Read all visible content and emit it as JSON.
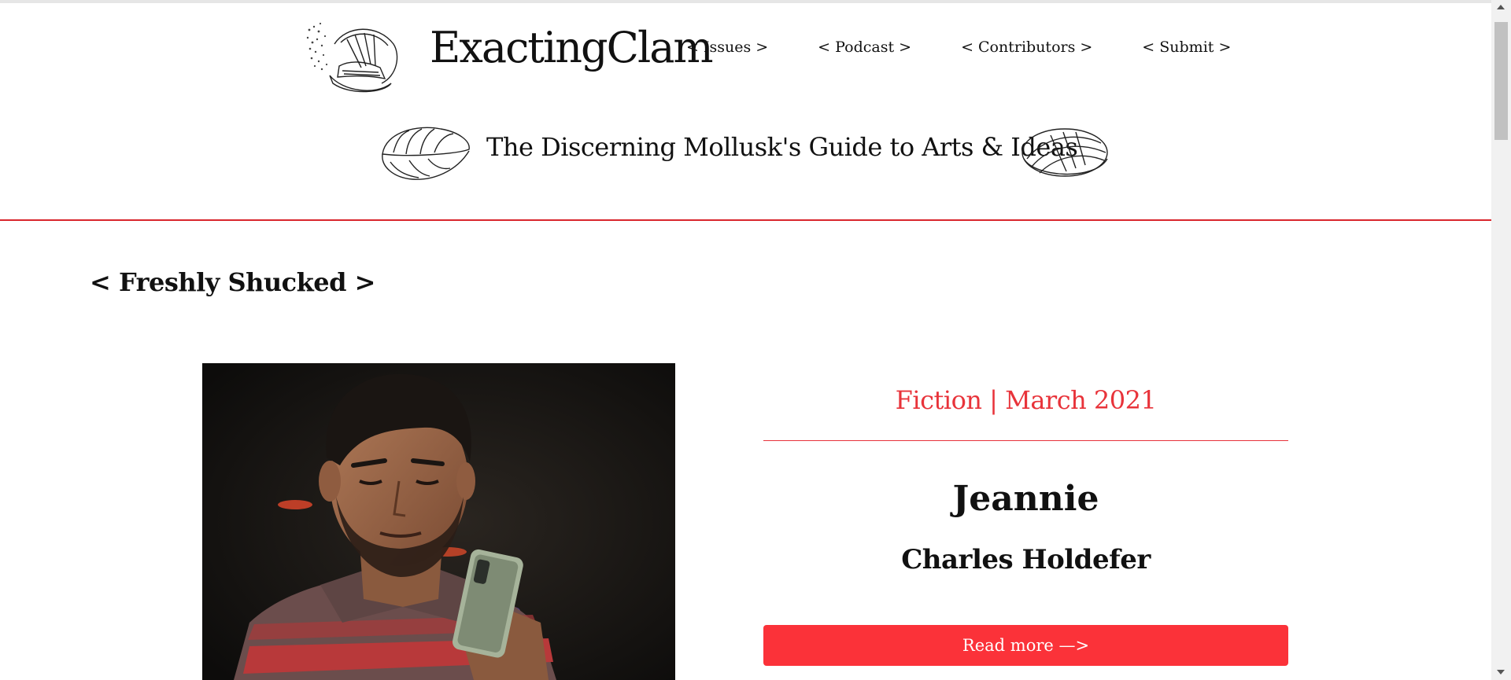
{
  "site": {
    "logo_text": "ExactingClam",
    "tagline": "The Discerning Mollusk's Guide to Arts & Ideas",
    "icons": [
      "clam-logo-icon",
      "open-shell-icon",
      "closed-shell-icon"
    ]
  },
  "nav": {
    "items": [
      {
        "label": "< Issues >"
      },
      {
        "label": "< Podcast >"
      },
      {
        "label": "< Contributors >"
      },
      {
        "label": "< Submit >"
      }
    ]
  },
  "section": {
    "title": "< Freshly Shucked >"
  },
  "feature": {
    "category": "Fiction | March 2021",
    "title": "Jeannie",
    "author": "Charles Holdefer",
    "read_more": "Read more —>"
  },
  "colors": {
    "accent": "#e8333a",
    "button": "#fb3239",
    "divider": "#d9262c"
  }
}
